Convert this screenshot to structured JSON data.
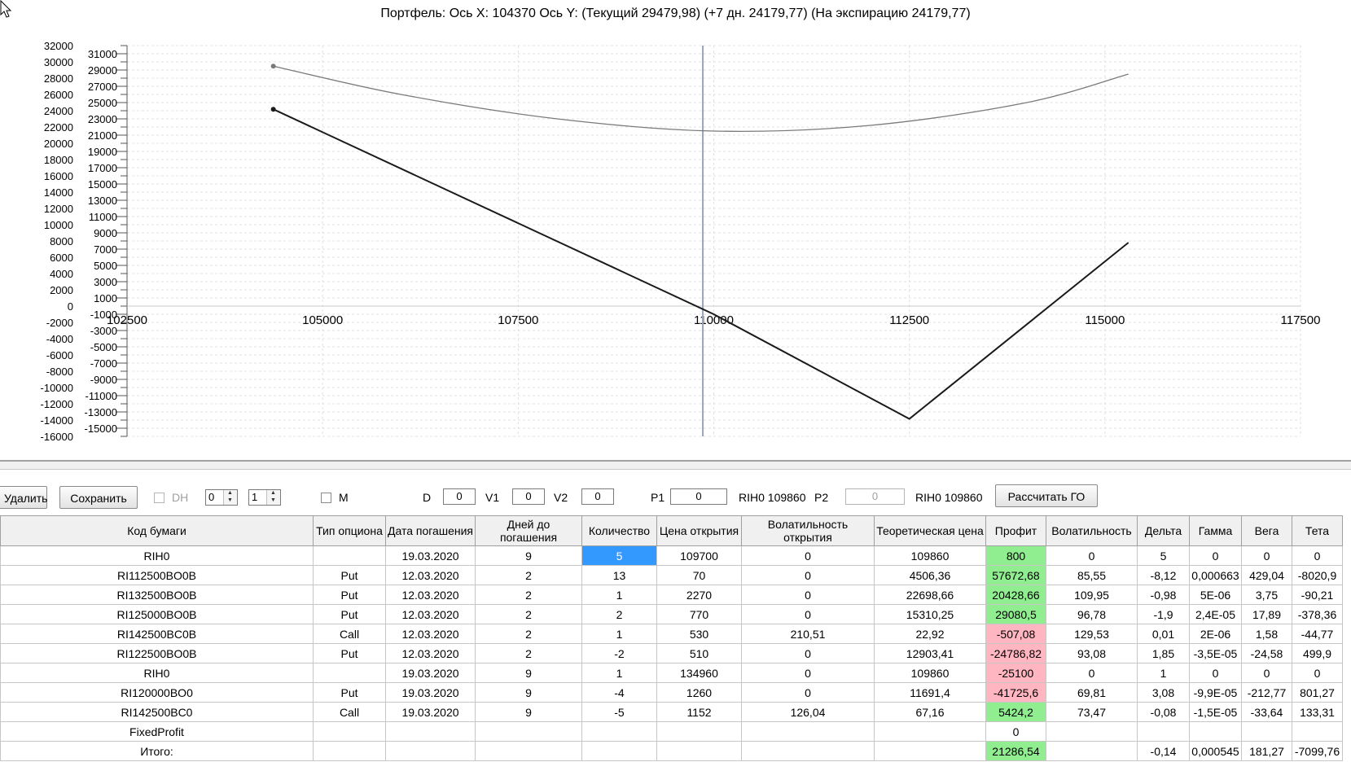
{
  "chart": {
    "title": "Портфель: Ось X: 104370 Ось Y:  (Текущий 29479,98)  (+7 дн. 24179,77)  (На экспирацию 24179,77)"
  },
  "chart_data": {
    "type": "line",
    "title": "Портфель: Ось X: 104370 Ось Y:  (Текущий 29479,98)  (+7 дн. 24179,77)  (На экспирацию 24179,77)",
    "xlim": [
      102500,
      117500
    ],
    "ylim": [
      -16000,
      32000
    ],
    "x_ticks": [
      "102500",
      "105000",
      "107500",
      "110000",
      "112500",
      "115000",
      "117500"
    ],
    "y_ticks_left": [
      "32000",
      "30000",
      "28000",
      "26000",
      "24000",
      "22000",
      "20000",
      "18000",
      "16000",
      "14000",
      "12000",
      "10000",
      "8000",
      "6000",
      "4000",
      "2000",
      "0",
      "-2000",
      "-4000",
      "-6000",
      "-8000",
      "-10000",
      "-12000",
      "-14000",
      "-16000"
    ],
    "y_ticks_right": [
      "31000",
      "29000",
      "27000",
      "25000",
      "23000",
      "21000",
      "19000",
      "17000",
      "15000",
      "13000",
      "11000",
      "9000",
      "7000",
      "5000",
      "3000",
      "1000",
      "-1000",
      "-3000",
      "-5000",
      "-7000",
      "-9000",
      "-11000",
      "-13000",
      "-15000"
    ],
    "current_price_line_x": 109860,
    "grid": true,
    "series": [
      {
        "color": "#7a7a7a",
        "x": [
          104370,
          106000,
          108000,
          110000,
          112000,
          114000,
          115300
        ],
        "y": [
          29480,
          26000,
          23000,
          21500,
          22200,
          25000,
          28500
        ]
      },
      {
        "color": "#1a1a1a",
        "x": [
          104370,
          110000,
          112500,
          115300
        ],
        "y": [
          24180,
          -1000,
          -13850,
          7800
        ]
      }
    ]
  },
  "toolbar": {
    "delete_label": "Удалить",
    "save_label": "Сохранить",
    "dh_label": "DH",
    "spin1_value": "0",
    "spin2_value": "1",
    "m_label": "M",
    "d_label": "D",
    "d_value": "0",
    "v1_label": "V1",
    "v1_value": "0",
    "v2_label": "V2",
    "v2_value": "0",
    "p1_label": "P1",
    "p1_value": "0",
    "instr1_label": "RIH0 109860",
    "p2_label": "P2",
    "p2_value": "0",
    "instr2_label": "RIH0 109860",
    "calc_label": "Рассчитать ГО"
  },
  "table": {
    "headers": [
      "Код бумаги",
      "Тип опциона",
      "Дата погашения",
      "Дней до погашения",
      "Количество",
      "Цена открытия",
      "Волатильность открытия",
      "Теоретическая цена",
      "Профит",
      "Волатильность",
      "Дельта",
      "Гамма",
      "Вега",
      "Тета"
    ],
    "rows": [
      {
        "cells": [
          "RIH0",
          "",
          "19.03.2020",
          "9",
          "5",
          "109700",
          "0",
          "109860",
          "800",
          "0",
          "5",
          "0",
          "0",
          "0"
        ],
        "profit": "pos",
        "qty_selected": true
      },
      {
        "cells": [
          "RI112500BO0B",
          "Put",
          "12.03.2020",
          "2",
          "13",
          "70",
          "0",
          "4506,36",
          "57672,68",
          "85,55",
          "-8,12",
          "0,000663",
          "429,04",
          "-8020,9"
        ],
        "profit": "pos"
      },
      {
        "cells": [
          "RI132500BO0B",
          "Put",
          "12.03.2020",
          "2",
          "1",
          "2270",
          "0",
          "22698,66",
          "20428,66",
          "109,95",
          "-0,98",
          "5E-06",
          "3,75",
          "-90,21"
        ],
        "profit": "pos"
      },
      {
        "cells": [
          "RI125000BO0B",
          "Put",
          "12.03.2020",
          "2",
          "2",
          "770",
          "0",
          "15310,25",
          "29080,5",
          "96,78",
          "-1,9",
          "2,4E-05",
          "17,89",
          "-378,36"
        ],
        "profit": "pos"
      },
      {
        "cells": [
          "RI142500BC0B",
          "Call",
          "12.03.2020",
          "2",
          "1",
          "530",
          "210,51",
          "22,92",
          "-507,08",
          "129,53",
          "0,01",
          "2E-06",
          "1,58",
          "-44,77"
        ],
        "profit": "neg"
      },
      {
        "cells": [
          "RI122500BO0B",
          "Put",
          "12.03.2020",
          "2",
          "-2",
          "510",
          "0",
          "12903,41",
          "-24786,82",
          "93,08",
          "1,85",
          "-3,5E-05",
          "-24,58",
          "499,9"
        ],
        "profit": "neg"
      },
      {
        "cells": [
          "RIH0",
          "",
          "19.03.2020",
          "9",
          "1",
          "134960",
          "0",
          "109860",
          "-25100",
          "0",
          "1",
          "0",
          "0",
          "0"
        ],
        "profit": "neg"
      },
      {
        "cells": [
          "RI120000BO0",
          "Put",
          "19.03.2020",
          "9",
          "-4",
          "1260",
          "0",
          "11691,4",
          "-41725,6",
          "69,81",
          "3,08",
          "-9,9E-05",
          "-212,77",
          "801,27"
        ],
        "profit": "neg"
      },
      {
        "cells": [
          "RI142500BC0",
          "Call",
          "19.03.2020",
          "9",
          "-5",
          "1152",
          "126,04",
          "67,16",
          "5424,2",
          "73,47",
          "-0,08",
          "-1,5E-05",
          "-33,64",
          "133,31"
        ],
        "profit": "pos"
      },
      {
        "cells": [
          "FixedProfit",
          "",
          "",
          "",
          "",
          "",
          "",
          "",
          "0",
          "",
          "",
          "",
          "",
          ""
        ],
        "profit": "none"
      },
      {
        "cells": [
          "Итого:",
          "",
          "",
          "",
          "",
          "",
          "",
          "",
          "21286,54",
          "",
          "-0,14",
          "0,000545",
          "181,27",
          "-7099,76"
        ],
        "profit": "pos"
      }
    ]
  }
}
